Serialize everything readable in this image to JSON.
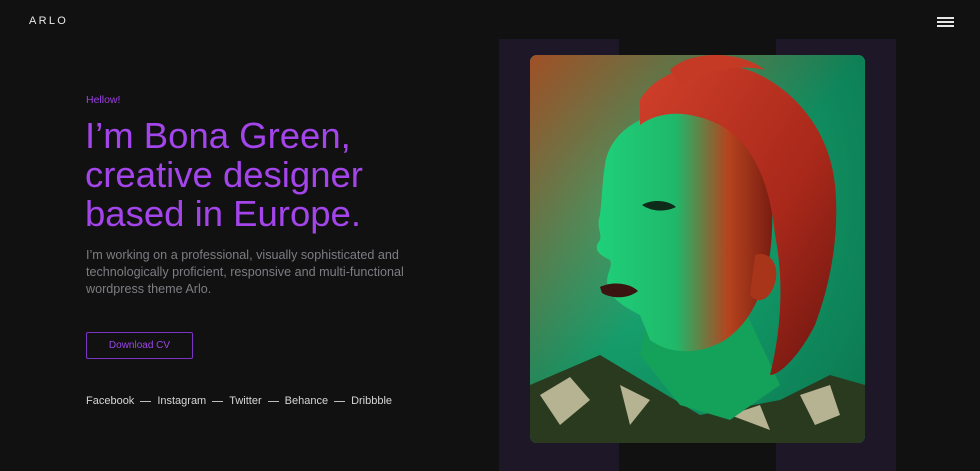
{
  "header": {
    "logo": "ARLO",
    "menu_icon": "hamburger-menu-icon"
  },
  "hero": {
    "greeting": "Hellow!",
    "headline": "I’m Bona Green, creative designer based in Europe.",
    "intro": "I’m working on a professional, visually sophisticated and technologically proficient, responsive and multi-functional wordpress theme Arlo.",
    "cv_button": "Download CV"
  },
  "social": {
    "links": [
      "Facebook",
      "Instagram",
      "Twitter",
      "Behance",
      "Dribbble"
    ]
  },
  "portrait": {
    "alt": "portrait-photo"
  },
  "colors": {
    "background": "#111112",
    "accent": "#a345ea",
    "panel": "#1d1728",
    "photo_green": "#139a6a",
    "photo_red": "#c8341c"
  }
}
